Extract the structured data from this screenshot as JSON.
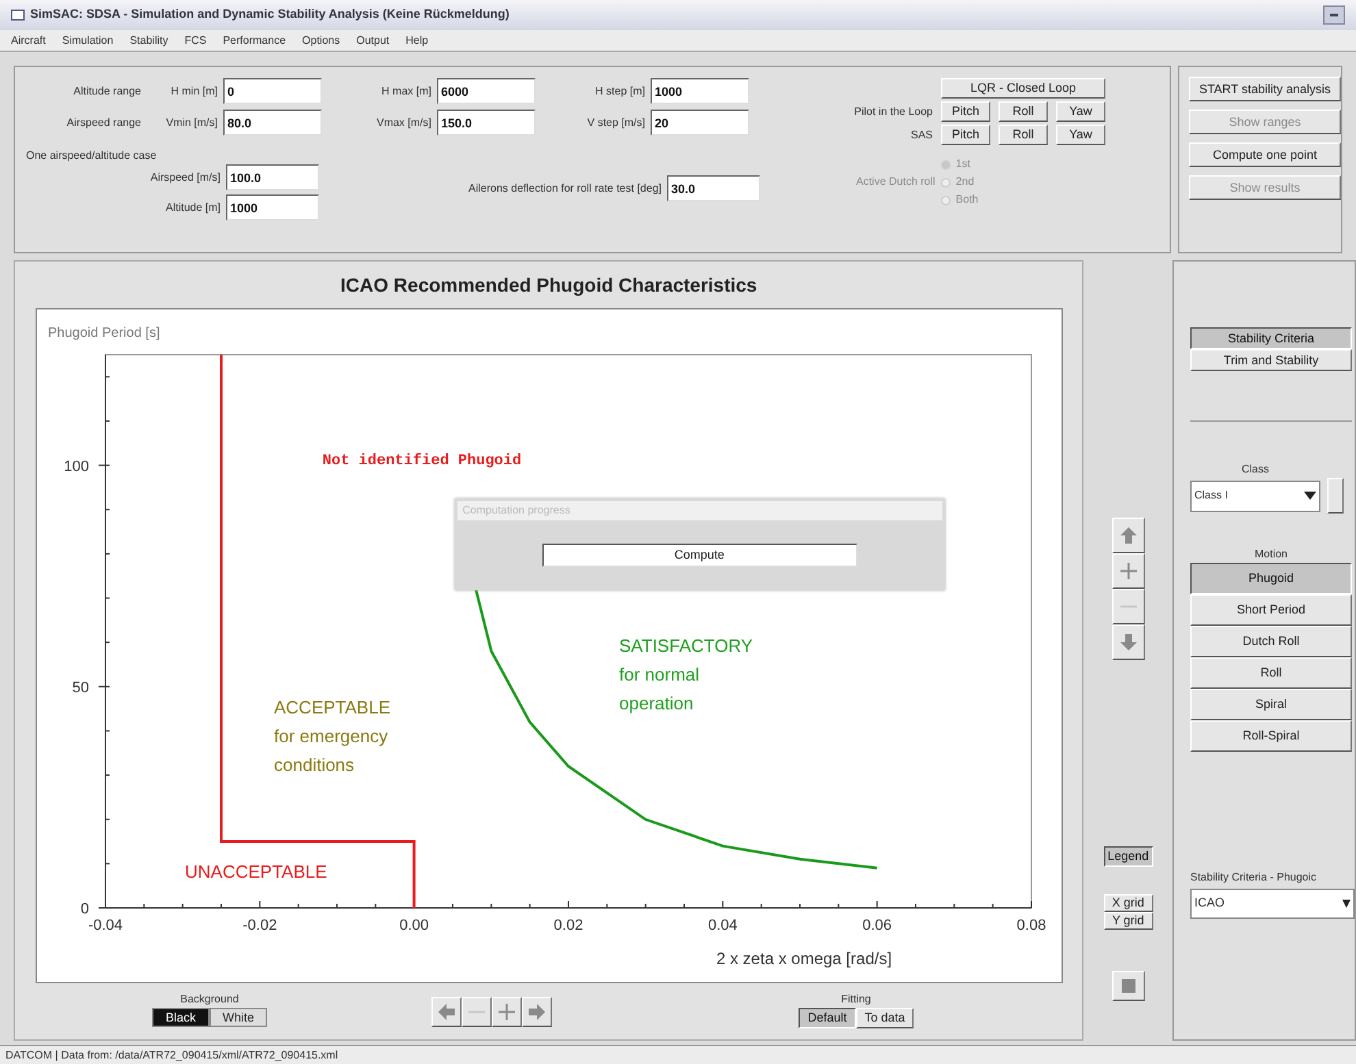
{
  "window": {
    "title": "SimSAC: SDSA - Simulation and Dynamic Stability Analysis (Keine Rückmeldung)"
  },
  "menu": [
    "Aircraft",
    "Simulation",
    "Stability",
    "FCS",
    "Performance",
    "Options",
    "Output",
    "Help"
  ],
  "ranges": [
    {
      "label": "Altitude range",
      "fields": [
        {
          "label": "H min [m]",
          "value": "0"
        },
        {
          "label": "H max [m]",
          "value": "6000"
        },
        {
          "label": "H step [m]",
          "value": "1000"
        }
      ]
    },
    {
      "label": "Airspeed range",
      "fields": [
        {
          "label": "Vmin [m/s]",
          "value": "80.0"
        },
        {
          "label": "Vmax [m/s]",
          "value": "150.0"
        },
        {
          "label": "V step [m/s]",
          "value": "20"
        }
      ]
    }
  ],
  "loop": {
    "header": "LQR - Closed Loop",
    "rows": [
      {
        "label": "Pilot in the Loop",
        "buttons": [
          "Pitch",
          "Roll",
          "Yaw"
        ]
      },
      {
        "label": "SAS",
        "buttons": [
          "Pitch",
          "Roll",
          "Yaw"
        ]
      }
    ]
  },
  "one_case": {
    "title": "One airspeed/altitude case",
    "fields": [
      {
        "label": "Airspeed [m/s]",
        "value": "100.0"
      },
      {
        "label": "Altitude [m]",
        "value": "1000"
      }
    ],
    "aileron": {
      "label": "Ailerons deflection for roll rate test [deg]",
      "value": "30.0"
    }
  },
  "active_mode": {
    "label": "Active Dutch roll",
    "disabled": true,
    "options": [
      {
        "label": "1st",
        "selected": true
      },
      {
        "label": "2nd",
        "selected": false
      },
      {
        "label": "Both",
        "selected": false
      }
    ]
  },
  "actions": [
    {
      "label": "START stability analysis",
      "disabled": false
    },
    {
      "label": "Show ranges",
      "disabled": true
    },
    {
      "label": "Compute one point",
      "disabled": false
    },
    {
      "label": "Show results",
      "disabled": true
    }
  ],
  "chart": {
    "title": "ICAO Recommended Phugoid Characteristics",
    "chart_data": {
      "type": "line",
      "xlabel": "2 x zeta x omega [rad/s]",
      "ylabel": "Phugoid Period [s]",
      "x": [
        -0.025,
        -0.025,
        0.0,
        0.0,
        0.008,
        0.01,
        0.015,
        0.02,
        0.03,
        0.04,
        0.05,
        0.06
      ],
      "series": [
        {
          "color": "#e81c1c",
          "values": [
            125,
            15,
            15,
            0,
            null,
            null,
            null,
            null,
            null,
            null,
            null,
            null
          ]
        },
        {
          "color": "#1a9a1a",
          "values": [
            null,
            null,
            null,
            null,
            72,
            58,
            42,
            32,
            20,
            14,
            11,
            9
          ]
        }
      ],
      "xlim": [
        -0.04,
        0.08
      ],
      "ylim": [
        0,
        125
      ],
      "xticks": [
        {
          "value": -0.04,
          "label": "-0.04"
        },
        {
          "value": -0.02,
          "label": "-0.02"
        },
        {
          "value": 0,
          "label": "0.00"
        },
        {
          "value": 0.02,
          "label": "0.02"
        },
        {
          "value": 0.04,
          "label": "0.04"
        },
        {
          "value": 0.06,
          "label": "0.06"
        },
        {
          "value": 0.08,
          "label": "0.08"
        }
      ],
      "yticks": [
        0,
        50,
        100
      ]
    },
    "regions": [
      {
        "kind": "mono",
        "lines": [
          "Not identified Phugoid"
        ],
        "color": "#e81c1c"
      },
      {
        "kind": "sans",
        "lines": [
          "ACCEPTABLE",
          "for emergency",
          "conditions"
        ],
        "color": "#8a7a10"
      },
      {
        "kind": "sans",
        "lines": [
          "SATISFACTORY",
          "for normal",
          "operation"
        ],
        "color": "#1fa01f"
      },
      {
        "kind": "sans",
        "lines": [
          "UNACCEPTABLE"
        ],
        "color": "#e81c1c"
      }
    ],
    "progress": {
      "title": "Computation progress",
      "button": "Compute"
    }
  },
  "zoom_buttons": [
    {
      "kind": "up",
      "disabled": false
    },
    {
      "kind": "plus",
      "disabled": false
    },
    {
      "kind": "minus",
      "disabled": true
    },
    {
      "kind": "down",
      "disabled": false
    }
  ],
  "legend": {
    "label": "Legend",
    "selected": true
  },
  "grid": [
    {
      "label": "X grid",
      "selected": false
    },
    {
      "label": "Y grid",
      "selected": false
    }
  ],
  "background": {
    "label": "Background",
    "options": [
      {
        "label": "Black",
        "selected": true
      },
      {
        "label": "White",
        "selected": false
      }
    ]
  },
  "nav": [
    {
      "kind": "left",
      "disabled": false
    },
    {
      "kind": "minus",
      "disabled": true
    },
    {
      "kind": "plus",
      "disabled": false
    },
    {
      "kind": "right",
      "disabled": false
    }
  ],
  "fitting": {
    "label": "Fitting",
    "options": [
      {
        "label": "Default",
        "selected": true
      },
      {
        "label": "To data",
        "selected": false
      }
    ]
  },
  "side_tabs": [
    {
      "label": "Stability Criteria",
      "selected": true
    },
    {
      "label": "Trim and Stability",
      "selected": false
    }
  ],
  "class_select": {
    "label": "Class",
    "value": "Class I"
  },
  "motion": {
    "label": "Motion",
    "items": [
      {
        "label": "Phugoid",
        "selected": true
      },
      {
        "label": "Short Period",
        "selected": false
      },
      {
        "label": "Dutch Roll",
        "selected": false
      },
      {
        "label": "Roll",
        "selected": false
      },
      {
        "label": "Spiral",
        "selected": false
      },
      {
        "label": "Roll-Spiral",
        "selected": false
      }
    ]
  },
  "criteria": {
    "label": "Stability Criteria - Phugoic",
    "value": "ICAO"
  },
  "status_bar": "DATCOM | Data from: /data/ATR72_090415/xml/ATR72_090415.xml"
}
